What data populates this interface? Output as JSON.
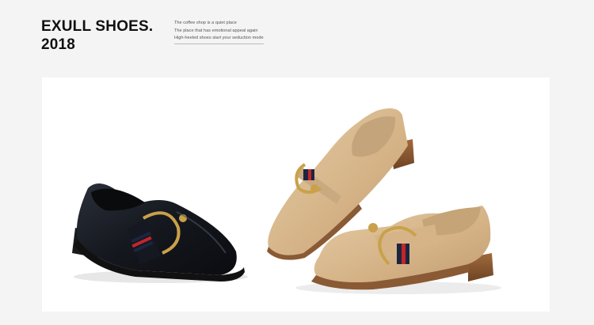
{
  "header": {
    "brand_line1": "EXULL SHOES.",
    "brand_line2": "2018",
    "taglines": [
      "The coffee shop is a quiet place",
      "The place that has emotional appeal again",
      "High-heeled shoes start your seduction mode"
    ]
  },
  "photo": {
    "subject": "loafers",
    "colors": {
      "black_leather": "#1a1e26",
      "tan_leather": "#d8b88f",
      "sole": "#8a5a35",
      "buckle_gold": "#c9a14a",
      "stripe_red": "#c0262b",
      "stripe_navy": "#1c2540"
    }
  }
}
